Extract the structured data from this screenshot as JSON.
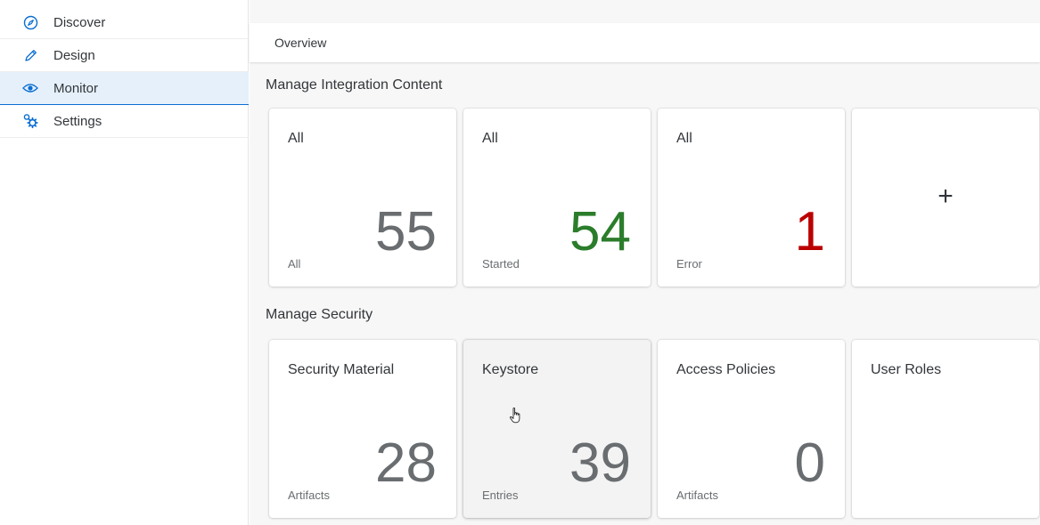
{
  "sidebar": {
    "items": [
      {
        "label": "Discover",
        "icon": "compass-icon",
        "selected": false
      },
      {
        "label": "Design",
        "icon": "pencil-icon",
        "selected": false
      },
      {
        "label": "Monitor",
        "icon": "eye-icon",
        "selected": true
      },
      {
        "label": "Settings",
        "icon": "settings-gears-icon",
        "selected": false
      }
    ]
  },
  "main": {
    "breadcrumb": "Overview",
    "sections": [
      {
        "title": "Manage Integration Content",
        "tiles": [
          {
            "title": "All",
            "value": "55",
            "unit": "All"
          },
          {
            "title": "All",
            "value": "54",
            "unit": "Started"
          },
          {
            "title": "All",
            "value": "1",
            "unit": "Error"
          },
          {
            "title": "",
            "value": "+",
            "unit": ""
          }
        ]
      },
      {
        "title": "Manage Security",
        "tiles": [
          {
            "title": "Security Material",
            "value": "28",
            "unit": "Artifacts"
          },
          {
            "title": "Keystore",
            "value": "39",
            "unit": "Entries"
          },
          {
            "title": "Access Policies",
            "value": "0",
            "unit": "Artifacts"
          },
          {
            "title": "User Roles",
            "value": "",
            "unit": ""
          }
        ]
      }
    ]
  },
  "colors": {
    "accent": "#0a6ed1",
    "selected_bg": "#e5f0fa",
    "value_neutral": "#6a6d70",
    "value_good": "#2b7d2b",
    "value_error": "#bb0000"
  }
}
